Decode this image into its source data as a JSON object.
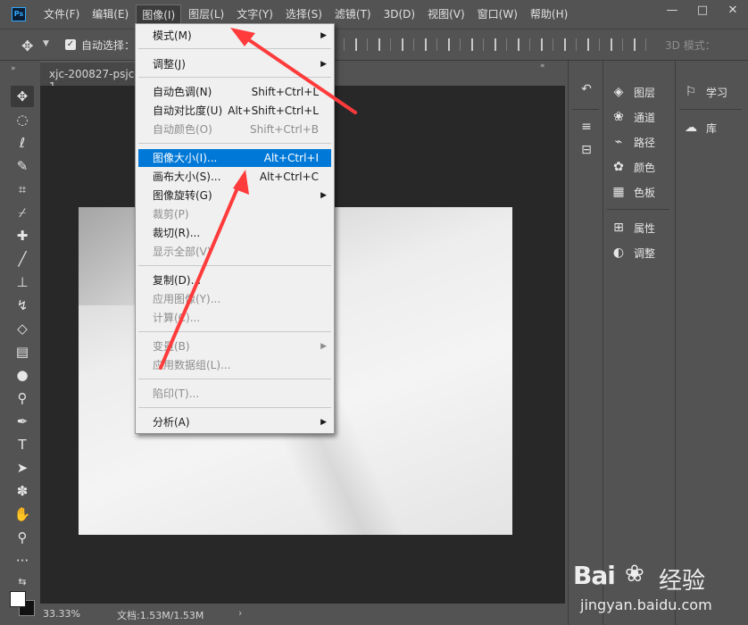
{
  "app": {
    "logo": "Ps",
    "menu": [
      "文件(F)",
      "编辑(E)",
      "图像(I)",
      "图层(L)",
      "文字(Y)",
      "选择(S)",
      "滤镜(T)",
      "3D(D)",
      "视图(V)",
      "窗口(W)",
      "帮助(H)"
    ],
    "active_menu": "图像(I)",
    "window_controls": [
      "—",
      "□",
      "✕"
    ]
  },
  "options_bar": {
    "auto_select_label": "自动选择：",
    "mode_3d_label": "3D 模式："
  },
  "document": {
    "tab_title": "xjc-200827-psjc-1",
    "zoom": "33.33%",
    "doc_size": "文档:1.53M/1.53M"
  },
  "dropdown": {
    "items": [
      {
        "label": "模式(M)",
        "shortcut": "",
        "submenu": true,
        "disabled": false
      },
      {
        "label": "调整(J)",
        "shortcut": "",
        "submenu": true,
        "disabled": false
      },
      {
        "label": "自动色调(N)",
        "shortcut": "Shift+Ctrl+L",
        "submenu": false,
        "disabled": false
      },
      {
        "label": "自动对比度(U)",
        "shortcut": "Alt+Shift+Ctrl+L",
        "submenu": false,
        "disabled": false
      },
      {
        "label": "自动颜色(O)",
        "shortcut": "Shift+Ctrl+B",
        "submenu": false,
        "disabled": true
      },
      {
        "label": "图像大小(I)...",
        "shortcut": "Alt+Ctrl+I",
        "submenu": false,
        "disabled": false,
        "highlight": true
      },
      {
        "label": "画布大小(S)...",
        "shortcut": "Alt+Ctrl+C",
        "submenu": false,
        "disabled": false
      },
      {
        "label": "图像旋转(G)",
        "shortcut": "",
        "submenu": true,
        "disabled": false
      },
      {
        "label": "裁剪(P)",
        "shortcut": "",
        "submenu": false,
        "disabled": true
      },
      {
        "label": "裁切(R)...",
        "shortcut": "",
        "submenu": false,
        "disabled": false
      },
      {
        "label": "显示全部(V)",
        "shortcut": "",
        "submenu": false,
        "disabled": true
      },
      {
        "label": "复制(D)...",
        "shortcut": "",
        "submenu": false,
        "disabled": false
      },
      {
        "label": "应用图像(Y)...",
        "shortcut": "",
        "submenu": false,
        "disabled": true
      },
      {
        "label": "计算(C)...",
        "shortcut": "",
        "submenu": false,
        "disabled": true
      },
      {
        "label": "变量(B)",
        "shortcut": "",
        "submenu": true,
        "disabled": true
      },
      {
        "label": "应用数据组(L)...",
        "shortcut": "",
        "submenu": false,
        "disabled": true
      },
      {
        "label": "陷印(T)...",
        "shortcut": "",
        "submenu": false,
        "disabled": true
      },
      {
        "label": "分析(A)",
        "shortcut": "",
        "submenu": true,
        "disabled": false
      }
    ]
  },
  "panels": {
    "group_a": [
      "图层",
      "通道",
      "路径",
      "颜色",
      "色板"
    ],
    "group_b": [
      "属性",
      "调整"
    ],
    "group_c": [
      "学习",
      "库"
    ]
  },
  "watermark": {
    "brand_left": "Bai",
    "brand_right": "经验",
    "url": "jingyan.baidu.com"
  },
  "colors": {
    "accent": "#0078d7",
    "arrow": "#ff3b3b",
    "ui_bg": "#535353",
    "canvas_bg": "#282828"
  }
}
